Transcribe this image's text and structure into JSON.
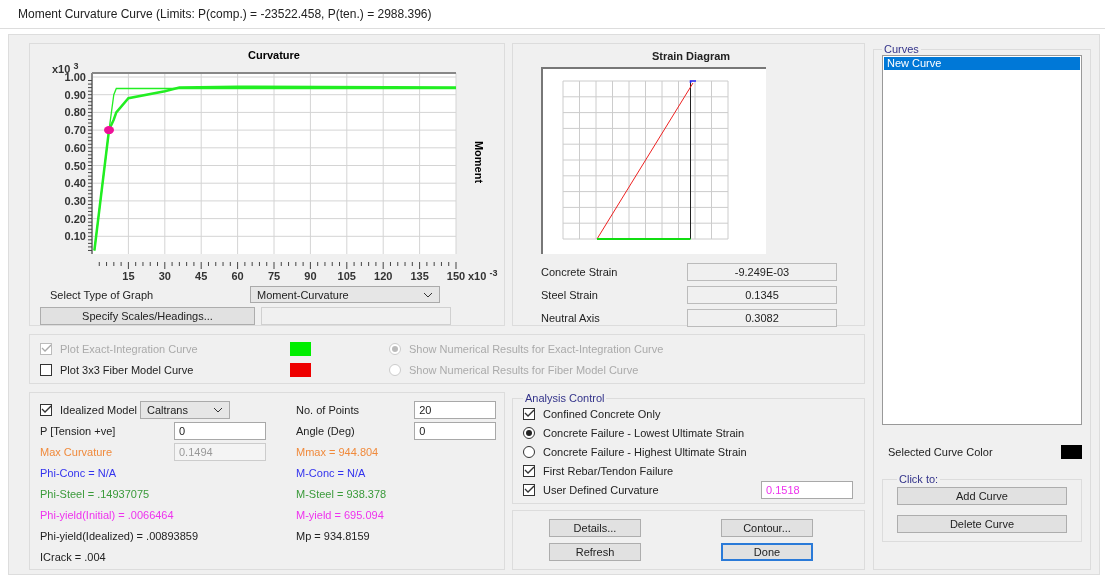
{
  "window": {
    "title": "Moment Curvature Curve (Limits:  P(comp.) = -23522.458, P(ten.) = 2988.396)"
  },
  "curvature_chart": {
    "y_multiplier": {
      "base": "x10",
      "exponent": "3"
    },
    "x_multiplier": {
      "base": "x10",
      "exponent": "-3"
    },
    "chart_data": {
      "type": "line",
      "xlabel": "Curvature",
      "ylabel": "Moment",
      "grid": true,
      "x": [
        1,
        7,
        9,
        10,
        15,
        30,
        36,
        60,
        150
      ],
      "series": [
        {
          "color": "#22ee22",
          "values": [
            0.02,
            0.7,
            0.76,
            0.8,
            0.88,
            0.92,
            0.94,
            0.945,
            0.94
          ]
        },
        {
          "color": "#22ee22",
          "values": [
            0.02,
            0.7,
            0.9,
            0.935,
            0.935,
            0.935,
            0.935,
            0.935,
            0.935
          ]
        },
        {
          "color": "#ee1199",
          "marker": true,
          "values": [
            null,
            0.7,
            null,
            null,
            null,
            null,
            null,
            null,
            null
          ]
        }
      ],
      "xlim": [
        0,
        150
      ],
      "ylim": [
        0,
        1
      ],
      "xticks": [
        15,
        30,
        45,
        60,
        75,
        90,
        105,
        120,
        135,
        150
      ],
      "yticks": [
        {
          "value": 0.1,
          "label": "0.10"
        },
        {
          "value": 0.2,
          "label": "0.20"
        },
        {
          "value": 0.3,
          "label": "0.30"
        },
        {
          "value": 0.4,
          "label": "0.40"
        },
        {
          "value": 0.5,
          "label": "0.50"
        },
        {
          "value": 0.6,
          "label": "0.60"
        },
        {
          "value": 0.7,
          "label": "0.70"
        },
        {
          "value": 0.8,
          "label": "0.80"
        },
        {
          "value": 0.9,
          "label": "0.90"
        },
        {
          "value": 1.0,
          "label": "1.00"
        }
      ]
    },
    "graph_type": {
      "label": "Select Type of Graph",
      "value": "Moment-Curvature"
    },
    "scales_button": "Specify Scales/Headings..."
  },
  "strain_diagram": {
    "title": "Strain Diagram",
    "results": [
      {
        "label": "Concrete Strain",
        "value": "-9.249E-03"
      },
      {
        "label": "Steel Strain",
        "value": "0.1345"
      },
      {
        "label": "Neutral Axis",
        "value": "0.3082"
      }
    ]
  },
  "plot_options": [
    {
      "label": "Plot Exact-Integration Curve",
      "checked": true,
      "disabled": true,
      "color": "#00ee00",
      "radio_label": "Show Numerical Results for Exact-Integration Curve",
      "selected": true
    },
    {
      "label": "Plot 3x3 Fiber Model Curve",
      "checked": false,
      "disabled": false,
      "color": "#ee0000",
      "radio_label": "Show Numerical Results for Fiber Model Curve",
      "selected": false
    }
  ],
  "idealized": {
    "label": "Idealized Model",
    "checked": true,
    "model": "Caltrans",
    "points": {
      "label": "No. of Points",
      "value": "20"
    },
    "tension": {
      "label": "P [Tension +ve]",
      "value": "0"
    },
    "angle": {
      "label": "Angle (Deg)",
      "value": "0"
    },
    "max_curvature": {
      "label": "Max Curvature",
      "value": "0.1494",
      "color": "#f08a3c"
    },
    "results": [
      {
        "text": "Mmax = 944.804",
        "color": "#f08a3c"
      },
      {
        "text": "Phi-Conc = N/A",
        "color": "#3333ee"
      },
      {
        "text": "M-Conc = N/A",
        "color": "#3333ee"
      },
      {
        "text": "Phi-Steel = .14937075",
        "color": "#3a9a3a"
      },
      {
        "text": "M-Steel = 938.378",
        "color": "#3a9a3a"
      },
      {
        "text": "Phi-yield(Initial) = .0066464",
        "color": "#ee33ee"
      },
      {
        "text": "M-yield = 695.094",
        "color": "#ee33ee"
      },
      {
        "text": "Phi-yield(Idealized) = .00893859",
        "color": "#222222"
      },
      {
        "text": "Mp = 934.8159",
        "color": "#222222"
      },
      {
        "text": "ICrack =  .004",
        "color": "#222222"
      }
    ]
  },
  "analysis_control": {
    "title": "Analysis Control",
    "items": [
      {
        "kind": "checkbox",
        "label": "Confined Concrete Only",
        "checked": true
      },
      {
        "kind": "radio",
        "label": "Concrete Failure - Lowest Ultimate Strain",
        "selected": true
      },
      {
        "kind": "radio",
        "label": "Concrete Failure - Highest Ultimate Strain",
        "selected": false
      },
      {
        "kind": "checkbox",
        "label": "First Rebar/Tendon Failure",
        "checked": true
      },
      {
        "kind": "checkbox",
        "label": "User Defined Curvature",
        "checked": true,
        "value": "0.1518"
      }
    ]
  },
  "buttons": [
    {
      "label": "Details...",
      "default": false
    },
    {
      "label": "Contour...",
      "default": false
    },
    {
      "label": "Refresh",
      "default": false
    },
    {
      "label": "Done",
      "default": true
    }
  ],
  "curves": {
    "title": "Curves",
    "items": [
      {
        "label": "New Curve",
        "selected": true
      }
    ],
    "color_label": "Selected Curve Color",
    "color": "#000000",
    "click_title": "Click to:",
    "buttons": [
      "Add Curve",
      "Delete Curve"
    ]
  }
}
